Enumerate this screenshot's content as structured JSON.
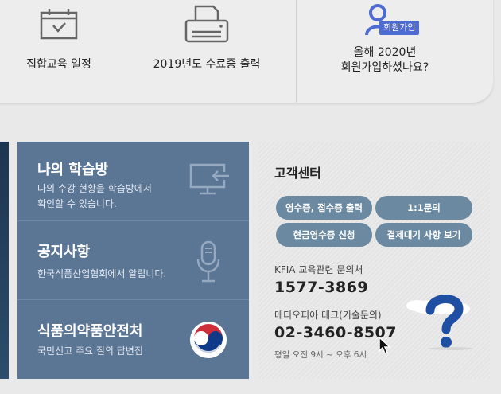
{
  "quick_menu": {
    "schedule_label": "집합교육 일정",
    "certificate_label": "2019년도 수료증 출력",
    "join_badge": "회원가입",
    "join_line1": "올해 2020년",
    "join_line2": "회원가입하셨나요?"
  },
  "info_blocks": [
    {
      "title": "나의 학습방",
      "desc_line1": "나의 수강 현황을 학습방에서",
      "desc_line2": "확인할 수 있습니다.",
      "icon": "monitor-arrow-icon"
    },
    {
      "title": "공지사항",
      "desc_line1": "한국식품산업협회에서 알립니다.",
      "icon": "microphone-icon"
    },
    {
      "title": "식품의약품안전처",
      "desc_line1": "국민신고 주요 질의 답변집",
      "icon": "taegeuk-icon"
    }
  ],
  "customer_center": {
    "title": "고객센터",
    "buttons": [
      "영수증, 접수증 출력",
      "1:1문의",
      "현금영수증 신청",
      "결제대기 사항 보기"
    ],
    "contact1_label": "KFIA 교육관련 문의처",
    "contact1_phone": "1577-3869",
    "contact2_label": "메디오피아 테크(기술문의)",
    "contact2_phone": "02-3460-8507",
    "hours": "평일 오전 9시 ~ 오후 6시",
    "icon": "question-mark-icon"
  },
  "colors": {
    "info_bg": "#5b7595",
    "pill_bg": "#6b8aa1",
    "badge_bg": "#4d6bd3",
    "question_blue": "#1e4fa3"
  }
}
